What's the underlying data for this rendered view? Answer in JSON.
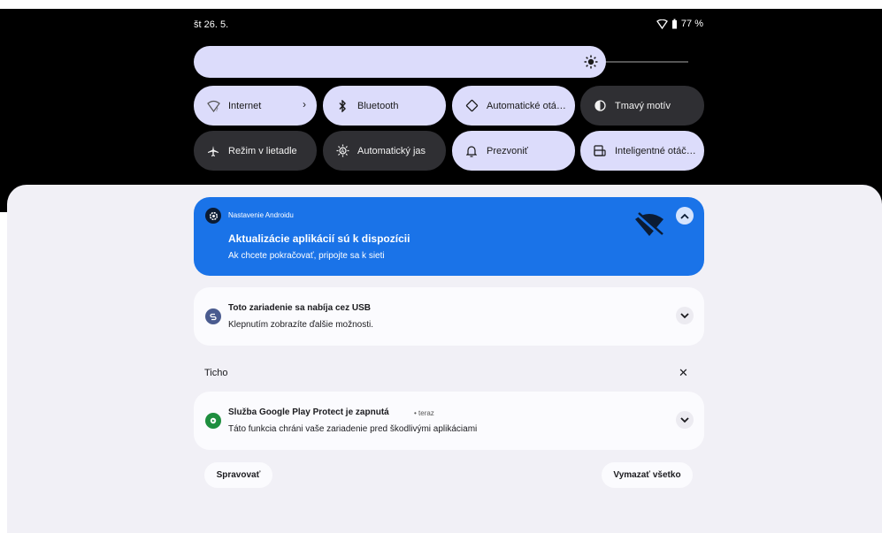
{
  "status_bar": {
    "date": "št 26. 5.",
    "battery": "77 %"
  },
  "brightness": {
    "level": 0.8
  },
  "tiles": [
    {
      "label": "Internet",
      "icon": "wifi-question-icon",
      "state": "on",
      "has_chevron": true
    },
    {
      "label": "Bluetooth",
      "icon": "bluetooth-icon",
      "state": "on"
    },
    {
      "label": "Automatické otá…",
      "icon": "rotate-icon",
      "state": "on"
    },
    {
      "label": "Tmavý motív",
      "icon": "dark-theme-icon",
      "state": "off"
    },
    {
      "label": "Režim v lietadle",
      "icon": "airplane-icon",
      "state": "off"
    },
    {
      "label": "Automatický jas",
      "icon": "auto-brightness-icon",
      "state": "off"
    },
    {
      "label": "Prezvoniť",
      "icon": "bell-icon",
      "state": "on"
    },
    {
      "label": "Inteligentné otáč…",
      "icon": "smart-rotate-icon",
      "state": "on"
    }
  ],
  "notifications": {
    "android_setup": {
      "app": "Nastavenie Androidu",
      "title": "Aktualizácie aplikácií sú k dispozícii",
      "body": "Ak chcete pokračovať, pripojte sa k sieti"
    },
    "usb": {
      "title": "Toto zariadenie sa nabíja cez USB",
      "body": "Klepnutím zobrazíte ďalšie možnosti."
    },
    "silent_label": "Ticho",
    "play_protect": {
      "title": "Služba Google Play Protect je zapnutá",
      "time": "• teraz",
      "body": "Táto funkcia chráni vaše zariadenie pred škodlivými aplikáciami"
    }
  },
  "buttons": {
    "manage": "Spravovať",
    "clear_all": "Vymazať všetko"
  },
  "colors": {
    "accent_blue": "#1a73e8",
    "tile_on": "#dcdcfb",
    "tile_off": "#2f2f33"
  }
}
